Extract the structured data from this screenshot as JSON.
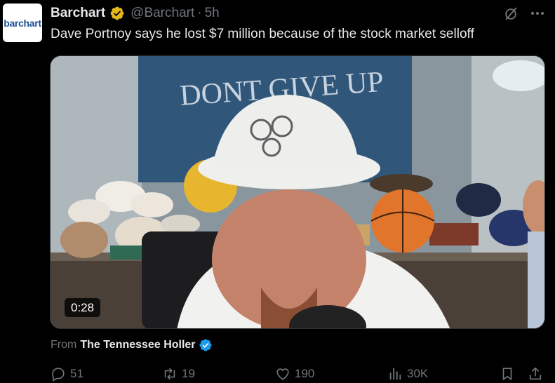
{
  "author": {
    "avatar_text": "barchart",
    "name": "Barchart",
    "handle": "@Barchart",
    "separator": "·",
    "time": "5h"
  },
  "tweet": {
    "text": "Dave Portnoy says he lost $7 million because of the stock market selloff"
  },
  "media": {
    "duration": "0:28",
    "banner_line1": "DONT GIVE UP"
  },
  "attribution": {
    "prefix": "From",
    "source": "The Tennessee Holler"
  },
  "actions": {
    "replies": "51",
    "reposts": "19",
    "likes": "190",
    "views": "30K"
  },
  "colors": {
    "background": "#000000",
    "text_primary": "#e7e9ea",
    "text_secondary": "#71767b",
    "verified_gold": "#e2b719",
    "verified_blue": "#1d9bf0",
    "brand_barchart": "#1a4e8f"
  },
  "icons": {
    "verified_org": "verified-gold-badge-icon",
    "verified_user": "verified-blue-badge-icon",
    "grok": "grok-icon",
    "more": "more-dots-icon",
    "reply": "reply-icon",
    "repost": "repost-icon",
    "like": "heart-icon",
    "views": "views-icon",
    "bookmark": "bookmark-icon",
    "share": "share-icon"
  }
}
